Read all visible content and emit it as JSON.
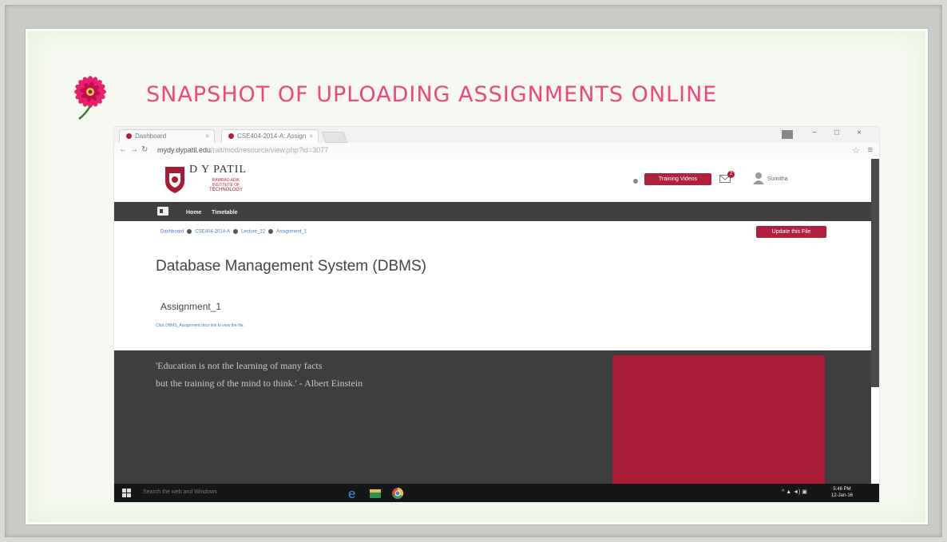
{
  "slide": {
    "title": "SNAPSHOT  OF UPLOADING ASSIGNMENTS ONLINE",
    "accent_color": "#f0457e",
    "decoration": "pink-gerbera-flower"
  },
  "browser": {
    "tabs": [
      {
        "label": "Dashboard",
        "active": false
      },
      {
        "label": "CSE404-2014-A: Assign",
        "active": true
      }
    ],
    "url_host": "mydy.dypatil.edu",
    "url_path": "/rait/mod/resource/view.php?id=3077",
    "window_controls": [
      "−",
      "□",
      "×"
    ]
  },
  "site": {
    "logo_name": "D Y PATIL",
    "logo_sub_line1": "RAMRAO ADIK",
    "logo_sub_line2": "INSTITUTE OF",
    "logo_sub_line3": "TECHNOLOGY",
    "training_button": "Training Videos",
    "notification_count": "2",
    "user_name": "Sumitha",
    "brand_color": "#b0203d"
  },
  "nav": {
    "items": [
      "Home",
      "Timetable"
    ]
  },
  "breadcrumb": [
    "Dashboard",
    "CSE404-2014-A",
    "Lecture_22",
    "Assignment_1"
  ],
  "page": {
    "update_button": "Update this File",
    "course_title": "Database Management System (DBMS)",
    "assignment_title": "Assignment_1",
    "assignment_link": "Click DBMS_Assignment.docx link to view the file."
  },
  "footer": {
    "quote_line1": "'Education is not the learning of many facts",
    "quote_line2": "but the training of the mind to think.' - Albert Einstein"
  },
  "taskbar": {
    "search_placeholder": "Search the web and Windows",
    "time": "5:46 PM",
    "date": "12-Jan-16"
  }
}
